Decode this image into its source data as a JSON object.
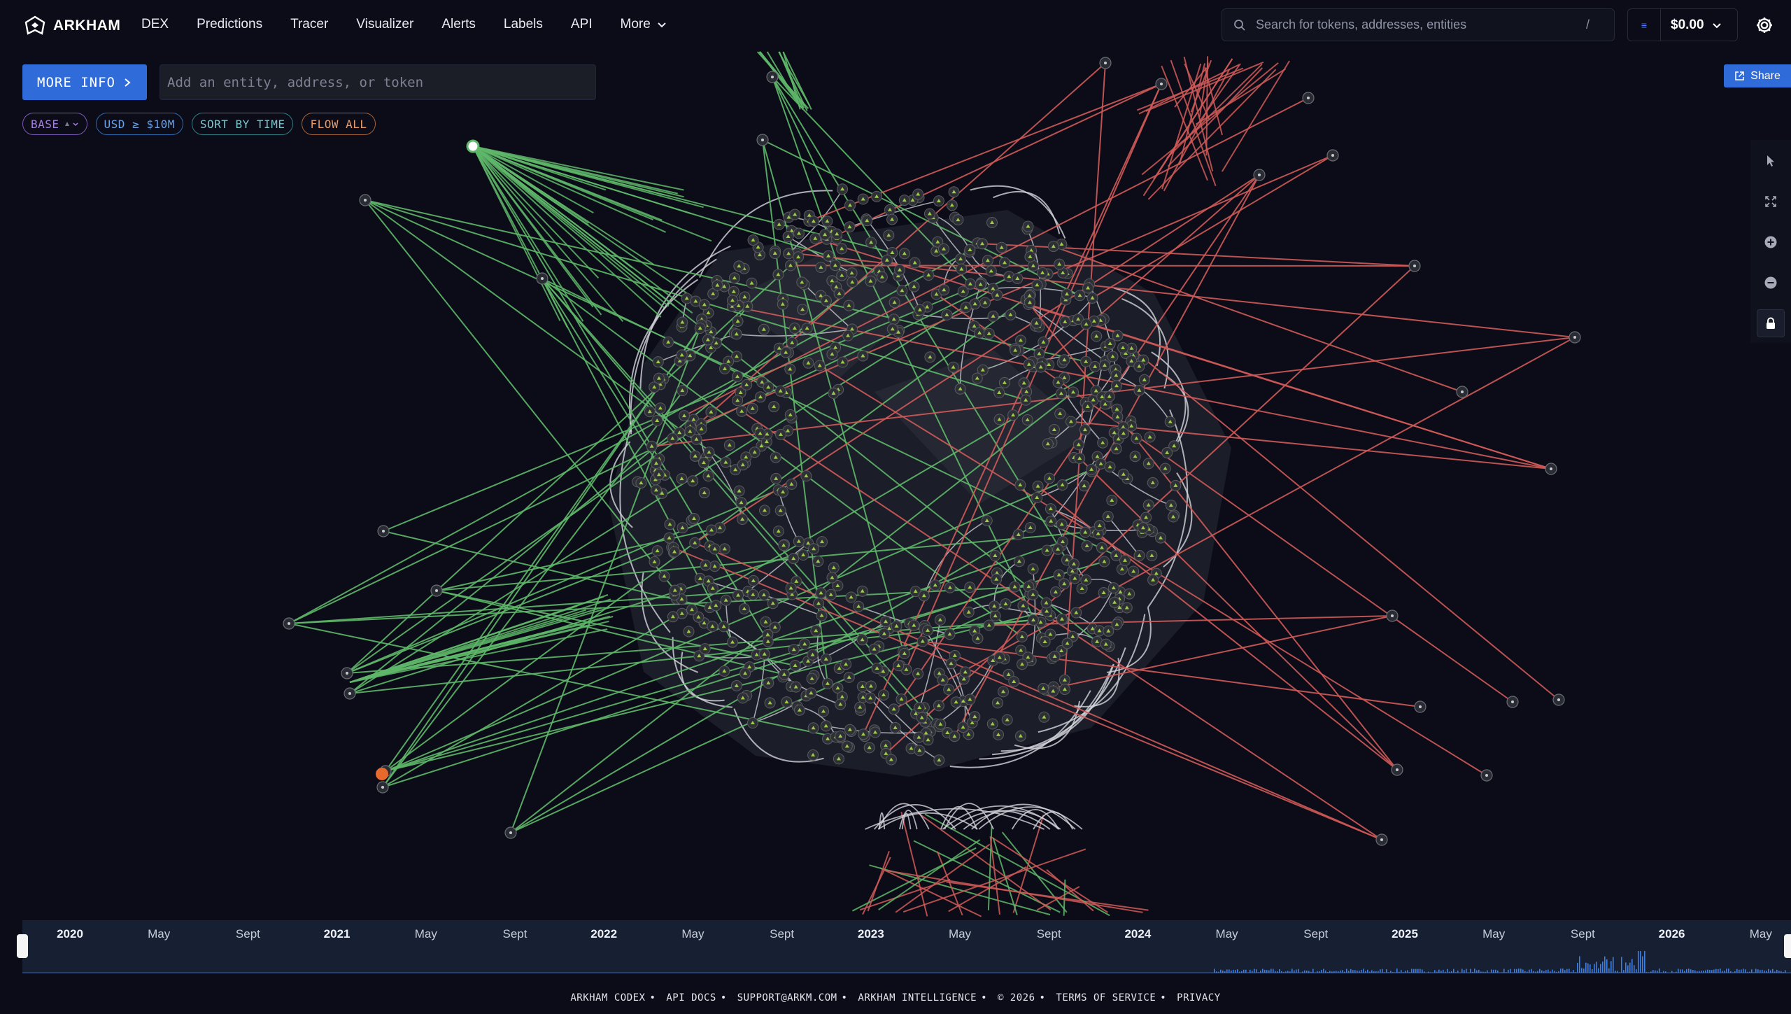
{
  "app": {
    "brand": "ARKHAM"
  },
  "nav": {
    "items": [
      "DEX",
      "Predictions",
      "Tracer",
      "Visualizer",
      "Alerts",
      "Labels",
      "API",
      "More"
    ]
  },
  "search": {
    "placeholder": "Search for tokens, addresses, entities",
    "shortcut": "/"
  },
  "wallet": {
    "balance": "$0.00",
    "icon": "wallet-icon"
  },
  "toolbar": {
    "more_info_label": "MORE INFO",
    "entity_placeholder": "Add an entity, address, or token",
    "share_label": "Share"
  },
  "filters": {
    "chain": "BASE",
    "usd": "USD ≥ $10M",
    "sort": "SORT BY TIME",
    "flow": "FLOW ALL"
  },
  "side_tools": [
    "pointer-icon",
    "fit-screen-icon",
    "zoom-in-icon",
    "zoom-out-icon",
    "lock-icon"
  ],
  "timeline": {
    "labels": [
      {
        "text": "2020",
        "year": true
      },
      {
        "text": "May",
        "year": false
      },
      {
        "text": "Sept",
        "year": false
      },
      {
        "text": "2021",
        "year": true
      },
      {
        "text": "May",
        "year": false
      },
      {
        "text": "Sept",
        "year": false
      },
      {
        "text": "2022",
        "year": true
      },
      {
        "text": "May",
        "year": false
      },
      {
        "text": "Sept",
        "year": false
      },
      {
        "text": "2023",
        "year": true
      },
      {
        "text": "May",
        "year": false
      },
      {
        "text": "Sept",
        "year": false
      },
      {
        "text": "2024",
        "year": true
      },
      {
        "text": "May",
        "year": false
      },
      {
        "text": "Sept",
        "year": false
      },
      {
        "text": "2025",
        "year": true
      },
      {
        "text": "May",
        "year": false
      },
      {
        "text": "Sept",
        "year": false
      },
      {
        "text": "2026",
        "year": true
      },
      {
        "text": "May",
        "year": false
      }
    ]
  },
  "colors": {
    "inflow": "#5fb86a",
    "outflow": "#d05a58",
    "internal": "#d4d6dc",
    "accent": "#2f6bd9",
    "selected_node": "#e8692c"
  },
  "footer": {
    "links": [
      "ARKHAM CODEX",
      "API DOCS",
      "SUPPORT@ARKM.COM",
      "ARKHAM INTELLIGENCE",
      "© 2026",
      "TERMS OF SERVICE",
      "PRIVACY"
    ],
    "separator": "•"
  }
}
